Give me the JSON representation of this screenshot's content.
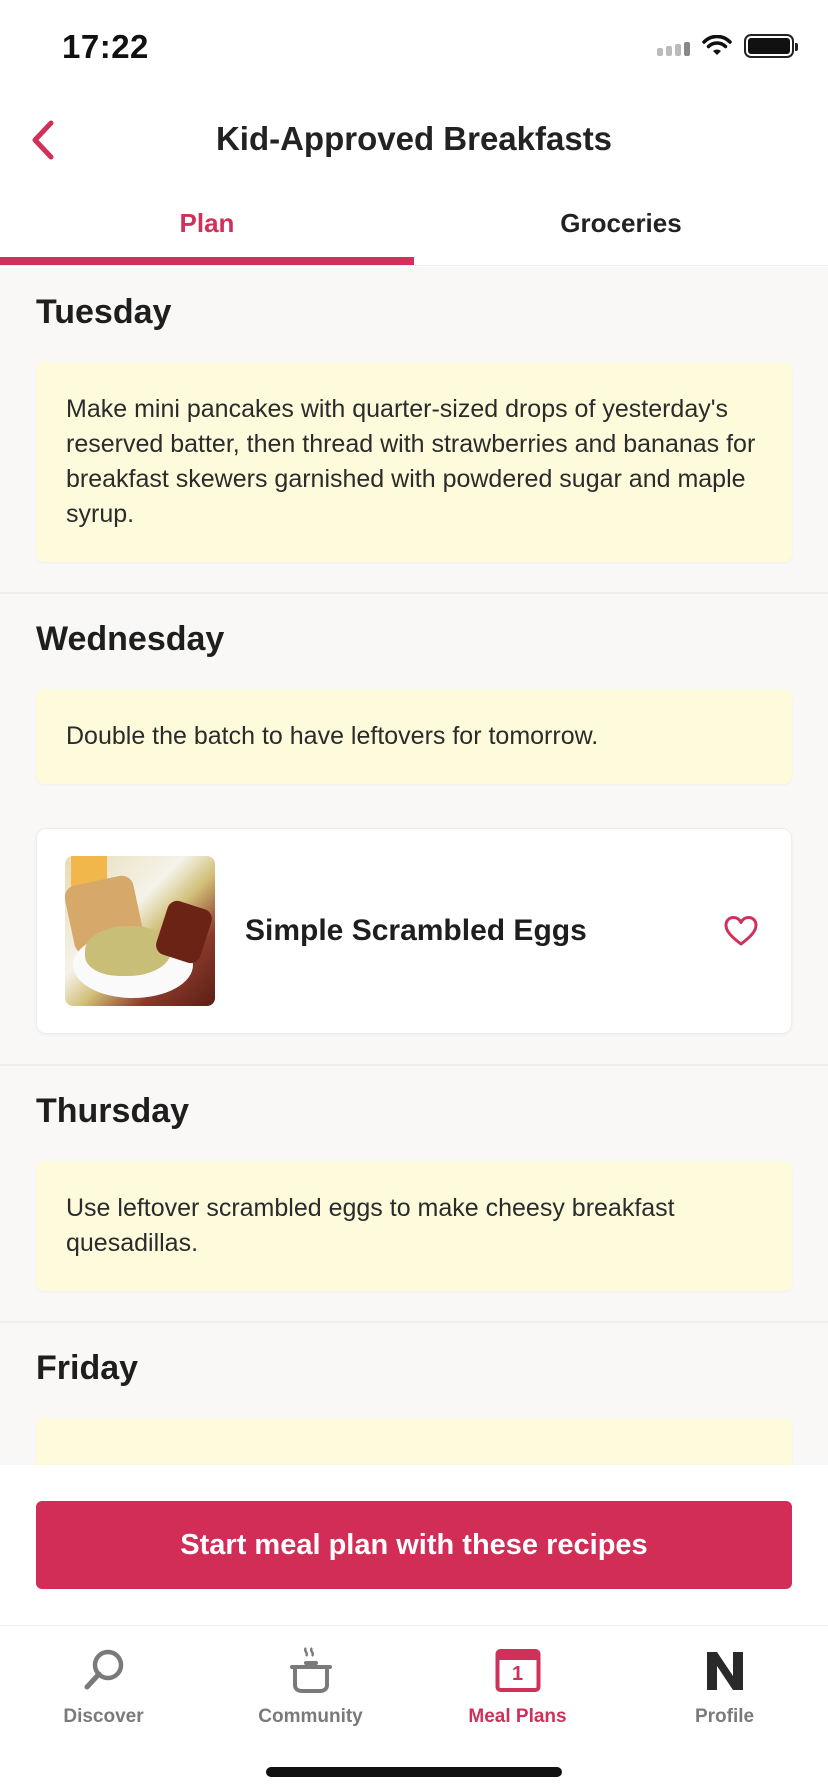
{
  "status_bar": {
    "time": "17:22"
  },
  "header": {
    "title": "Kid-Approved Breakfasts",
    "back_icon": "chevron-left-icon"
  },
  "tabs": [
    {
      "label": "Plan",
      "active": true
    },
    {
      "label": "Groceries",
      "active": false
    }
  ],
  "days": [
    {
      "day": "Tuesday",
      "note": "Make mini pancakes with quarter-sized drops of yesterday's reserved batter, then thread with strawberries and bananas for breakfast skewers garnished with powdered sugar and maple syrup."
    },
    {
      "day": "Wednesday",
      "note": "Double the batch to have leftovers for tomorrow.",
      "recipe": {
        "name": "Simple Scrambled Eggs",
        "favorite_icon": "heart-outline-icon"
      }
    },
    {
      "day": "Thursday",
      "note": "Use leftover scrambled eggs to make cheesy breakfast quesadillas."
    },
    {
      "day": "Friday"
    }
  ],
  "cta": {
    "label": "Start meal plan with these recipes"
  },
  "bottom_nav": [
    {
      "label": "Discover",
      "icon": "search-icon",
      "active": false
    },
    {
      "label": "Community",
      "icon": "pot-icon",
      "active": false
    },
    {
      "label": "Meal Plans",
      "icon": "calendar-icon",
      "calendar_day": "1",
      "active": true
    },
    {
      "label": "Profile",
      "icon": "n-logo-icon",
      "active": false
    }
  ],
  "colors": {
    "accent": "#d0315a",
    "note_bg": "#fdfbdc",
    "content_bg": "#f9f8f6"
  }
}
